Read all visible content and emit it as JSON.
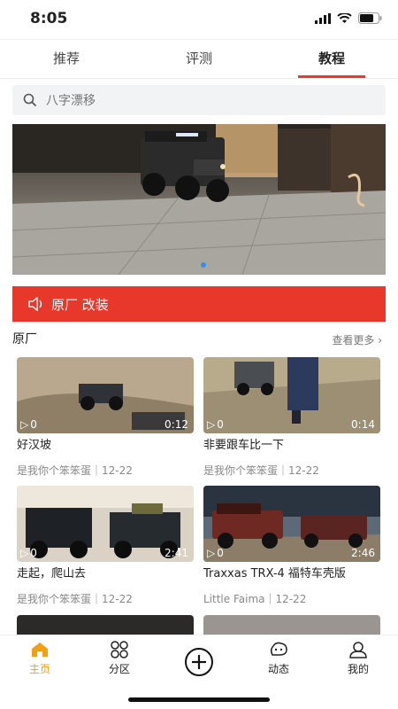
{
  "status": {
    "time": "8:05"
  },
  "tabs": [
    {
      "label": "推荐"
    },
    {
      "label": "评测"
    },
    {
      "label": "教程"
    }
  ],
  "search": {
    "placeholder": "八字漂移"
  },
  "notice": {
    "text": "原厂 改装"
  },
  "section": {
    "title": "原厂",
    "more": "查看更多"
  },
  "cards": [
    {
      "title": "好汉坡",
      "meta": "是我你个笨笨蛋｜12-22",
      "views": "0",
      "duration": "0:12"
    },
    {
      "title": "非要跟车比一下",
      "meta": "是我你个笨笨蛋｜12-22",
      "views": "0",
      "duration": "0:14"
    },
    {
      "title": "走起，爬山去",
      "meta": "是我你个笨笨蛋｜12-22",
      "views": "0",
      "duration": "2:41"
    },
    {
      "title": "Traxxas TRX-4 福特车壳版",
      "meta": "Little Faima｜12-22",
      "views": "0",
      "duration": "2:46"
    }
  ],
  "nav": [
    {
      "label": "主页"
    },
    {
      "label": "分区"
    },
    {
      "label": ""
    },
    {
      "label": "动态"
    },
    {
      "label": "我的"
    }
  ],
  "colors": {
    "accent": "#e8372b",
    "nav_active": "#f0a016"
  }
}
